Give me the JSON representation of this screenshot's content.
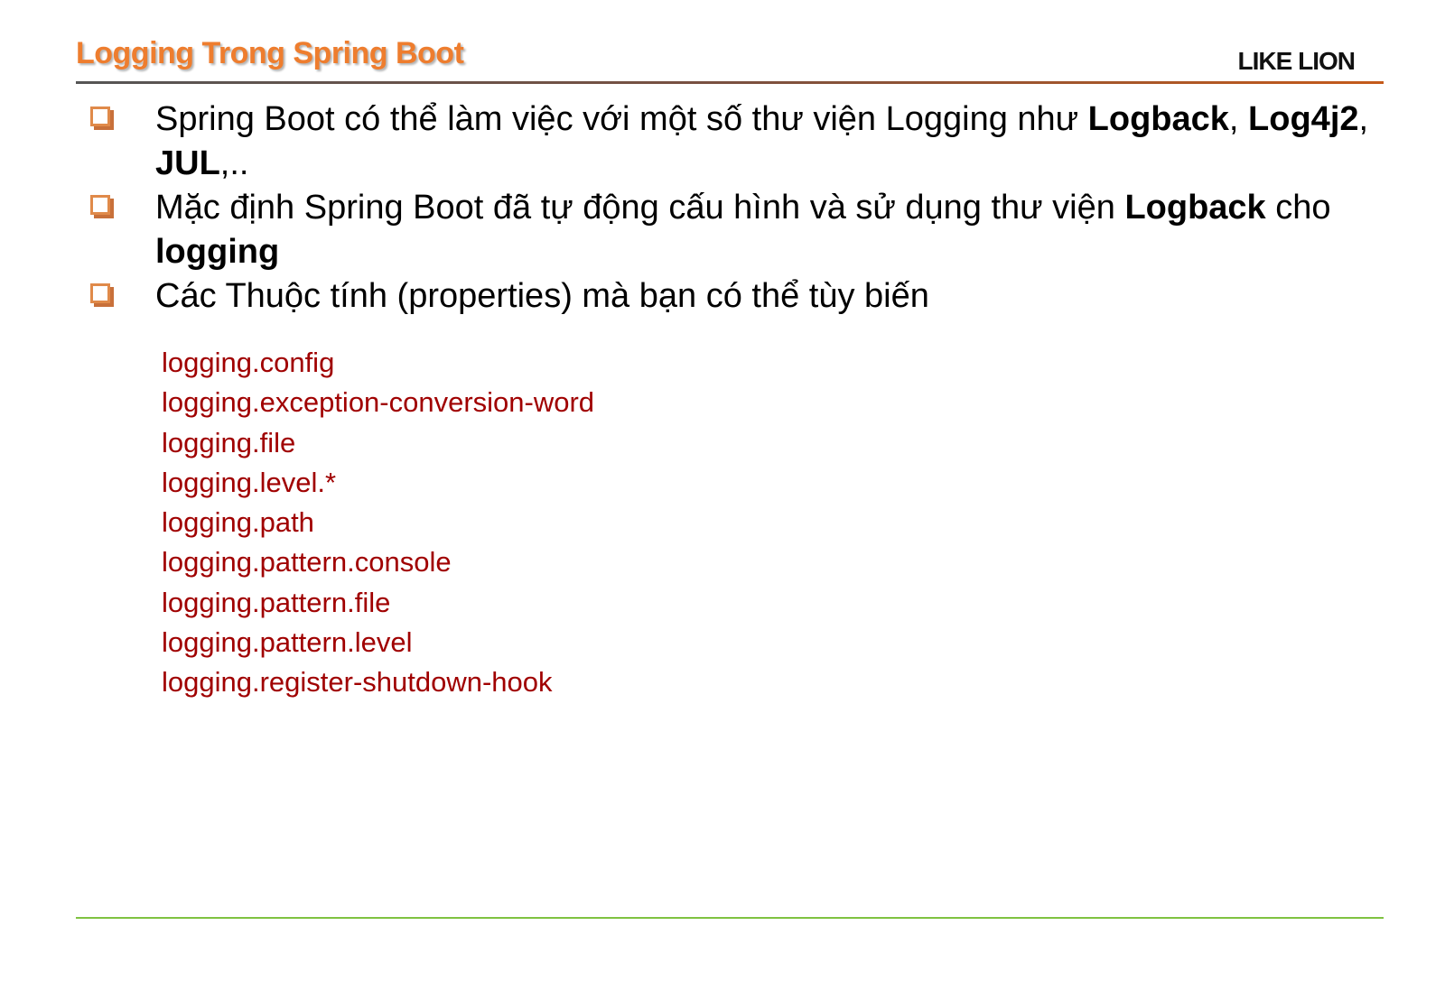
{
  "header": {
    "title": "Logging Trong Spring Boot",
    "logo": "LIKE LION"
  },
  "colors": {
    "title": "#ee7d2e",
    "bullet_box": "#e08a4a",
    "property_text": "#a00000",
    "footer_line": "#7fc241"
  },
  "bullets": [
    {
      "segments": [
        {
          "text": "Spring Boot  có thể làm việc với một số thư viện Logging như ",
          "bold": false
        },
        {
          "text": "Logback",
          "bold": true
        },
        {
          "text": ", ",
          "bold": false
        },
        {
          "text": "Log4j2",
          "bold": true
        },
        {
          "text": ", ",
          "bold": false
        },
        {
          "text": "JUL",
          "bold": true
        },
        {
          "text": ",..",
          "bold": false
        }
      ]
    },
    {
      "segments": [
        {
          "text": "Mặc định Spring Boot đã tự động cấu hình và sử dụng thư viện ",
          "bold": false
        },
        {
          "text": "Logback",
          "bold": true
        },
        {
          "text": " cho ",
          "bold": false
        },
        {
          "text": "logging",
          "bold": true
        }
      ]
    },
    {
      "segments": [
        {
          "text": "Các Thuộc tính (properties) mà bạn có thể tùy biến",
          "bold": false
        }
      ]
    }
  ],
  "properties": [
    "logging.config",
    "logging.exception-conversion-word",
    "logging.file",
    "logging.level.*",
    "logging.path",
    "logging.pattern.console",
    "logging.pattern.file",
    "logging.pattern.level",
    "logging.register-shutdown-hook"
  ]
}
